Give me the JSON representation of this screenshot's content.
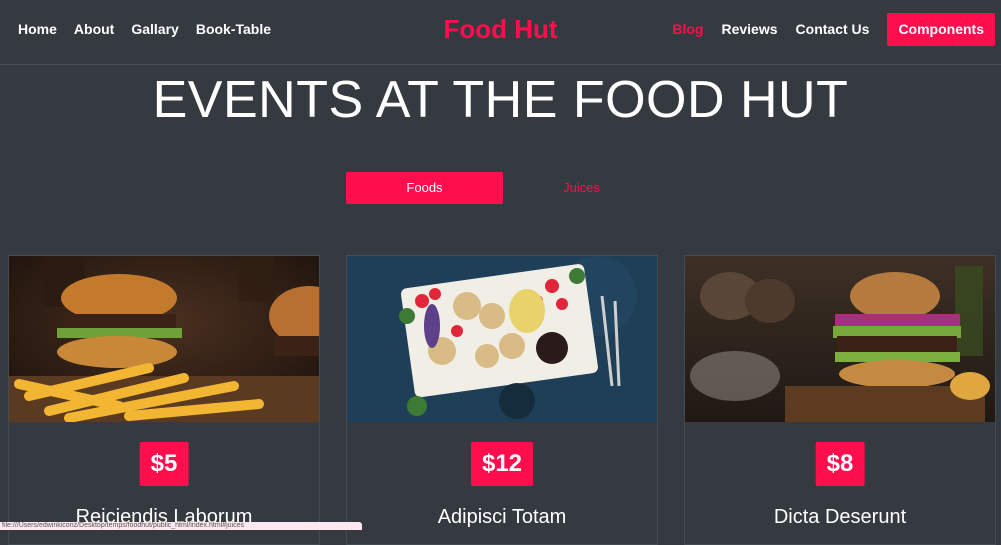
{
  "nav": {
    "left": [
      "Home",
      "About",
      "Gallary",
      "Book-Table"
    ],
    "brand": "Food Hut",
    "right": [
      "Blog",
      "Reviews",
      "Contact Us"
    ],
    "cta": "Components",
    "accent": "#ff0e4e"
  },
  "section": {
    "title": "EVENTS AT THE FOOD HUT",
    "tabs": [
      {
        "label": "Foods",
        "active": true
      },
      {
        "label": "Juices",
        "active": false
      }
    ]
  },
  "cards": [
    {
      "price": "$5",
      "title": "Reiciendis Laborum",
      "image": "burger-fries-photo"
    },
    {
      "price": "$12",
      "title": "Adipisci Totam",
      "image": "fruit-crackers-platter-photo"
    },
    {
      "price": "$8",
      "title": "Dicta Deserunt",
      "image": "burger-photo"
    }
  ],
  "status": {
    "url": "file:///Users/edwinkiconz/Desktop/temps/foodhut/public_html/index.html#juices"
  }
}
